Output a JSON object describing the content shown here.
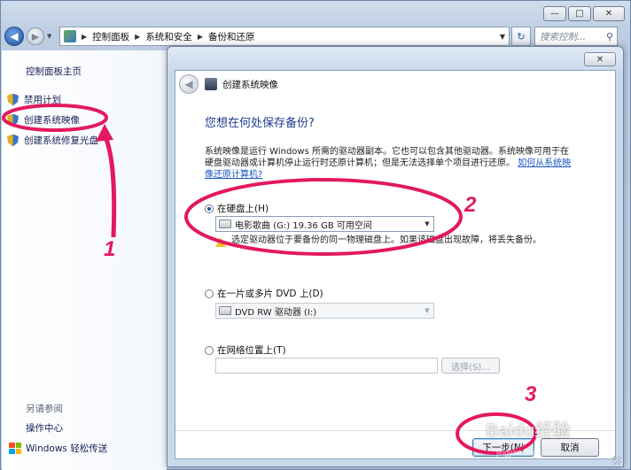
{
  "window": {
    "caption_buttons": [
      "—",
      "□",
      "✕"
    ]
  },
  "address_bar": {
    "crumbs": [
      "控制面板",
      "系统和安全",
      "备份和还原"
    ],
    "search_placeholder": "搜索控制...",
    "search_icon": "search-icon",
    "refresh_icon": "refresh-icon"
  },
  "sidebar": {
    "home": "控制面板主页",
    "items": [
      {
        "label": "禁用计划",
        "icon": "shield-icon"
      },
      {
        "label": "创建系统映像",
        "icon": "shield-icon"
      },
      {
        "label": "创建系统修复光盘",
        "icon": "shield-icon"
      }
    ],
    "see_also": "另请参阅",
    "bottom_links": [
      "操作中心",
      "Windows 轻松传送"
    ]
  },
  "dialog": {
    "close_label": "✕",
    "title": "创建系统映像",
    "heading": "您想在何处保存备份?",
    "description": "系统映像是运行 Windows 所需的驱动器副本。它也可以包含其他驱动器。系统映像可用于在硬盘驱动器或计算机停止运行时还原计算机；但是无法选择单个项目进行还原。",
    "description_link": "如何从系统映像还原计算机?",
    "options": {
      "hard_disk": {
        "label": "在硬盘上(H)",
        "selected": true,
        "combo_value": "电影歌曲 (G:)  19.36 GB 可用空间",
        "warning": "选定驱动器位于要备份的同一物理磁盘上。如果该磁盘出现故障，将丢失备份。"
      },
      "dvd": {
        "label": "在一片或多片 DVD 上(D)",
        "selected": false,
        "combo_value": "DVD RW 驱动器 (I:)"
      },
      "network": {
        "label": "在网络位置上(T)",
        "selected": false,
        "field_value": "",
        "browse_label": "选择(S)..."
      }
    },
    "next_label": "下一步(N)",
    "cancel_label": "取消"
  },
  "annotations": {
    "step1": "1",
    "step2": "2",
    "step3": "3",
    "accent_color": "#e2195f"
  },
  "watermark": {
    "text": "Baidu经验",
    "sub": "jingyan.baidu.com"
  }
}
